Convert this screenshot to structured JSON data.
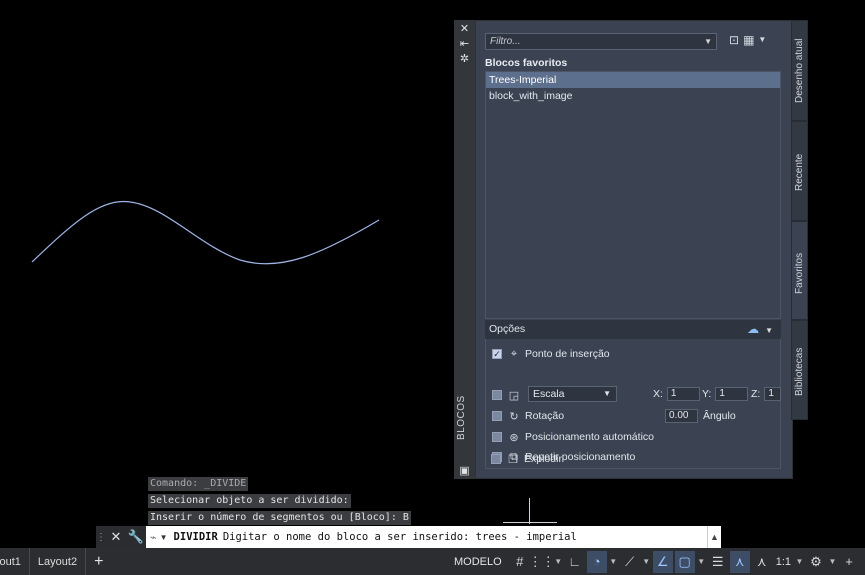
{
  "command_history": [
    "Comando: _DIVIDE",
    "Selecionar objeto a ser dividido:",
    "Inserir o número de segmentos ou [Bloco]: B"
  ],
  "command_line": {
    "command": "DIVIDIR",
    "prompt": "Digitar o nome do bloco a ser inserido: trees - imperial"
  },
  "statusbar": {
    "tabs": [
      "yout1",
      "Layout2"
    ],
    "add_tab": "+",
    "model_label": "MODELO",
    "scale_label": "1:1"
  },
  "palette": {
    "title": "BLOCOS",
    "filter_placeholder": "Filtro...",
    "section_title": "Blocos favoritos",
    "items": [
      "Trees-Imperial",
      "block_with_image"
    ],
    "selected_item": "Trees-Imperial",
    "tabs": [
      "Desenho atual",
      "Recente",
      "Favoritos",
      "Bibliotecas"
    ],
    "active_tab": "Favoritos",
    "options": {
      "title": "Opções",
      "insertion_point": "Ponto de inserção",
      "scale_select": "Escala",
      "x_label": "X:",
      "x_value": "1",
      "y_label": "Y:",
      "y_value": "1",
      "z_label": "Z:",
      "z_value": "1",
      "rotation": "Rotação",
      "angle_value": "0.00",
      "angle_label": "Ângulo",
      "auto_placement": "Posicionamento automático",
      "repeat_placement": "Repetir posicionamento",
      "explode": "Explodir",
      "insertion_point_checked": true
    }
  },
  "colors": {
    "canvas": "#000000",
    "palette_bg": "#3b4352",
    "selected_item": "#5c6f8d",
    "curve": "#9fb4e6"
  }
}
